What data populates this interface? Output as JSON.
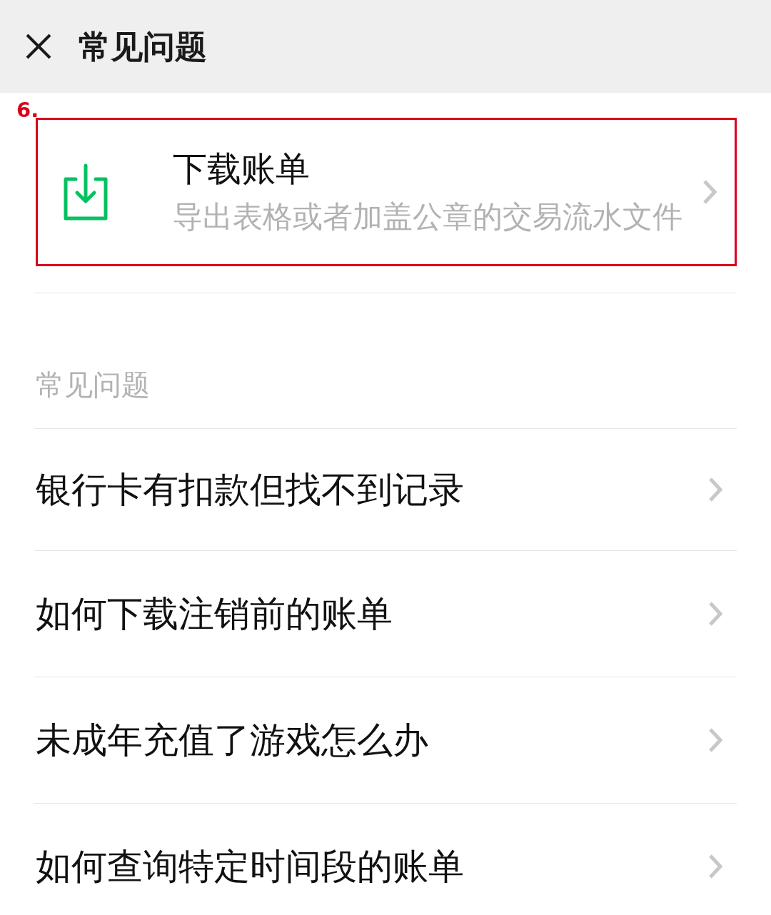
{
  "header": {
    "title": "常见问题"
  },
  "feature": {
    "title": "下载账单",
    "subtitle": "导出表格或者加盖公章的交易流水文件",
    "highlighted": true,
    "annotation": "6."
  },
  "faq": {
    "heading": "常见问题",
    "items": [
      "银行卡有扣款但找不到记录",
      "如何下载注销前的账单",
      "未成年充值了游戏怎么办",
      "如何查询特定时间段的账单"
    ]
  }
}
